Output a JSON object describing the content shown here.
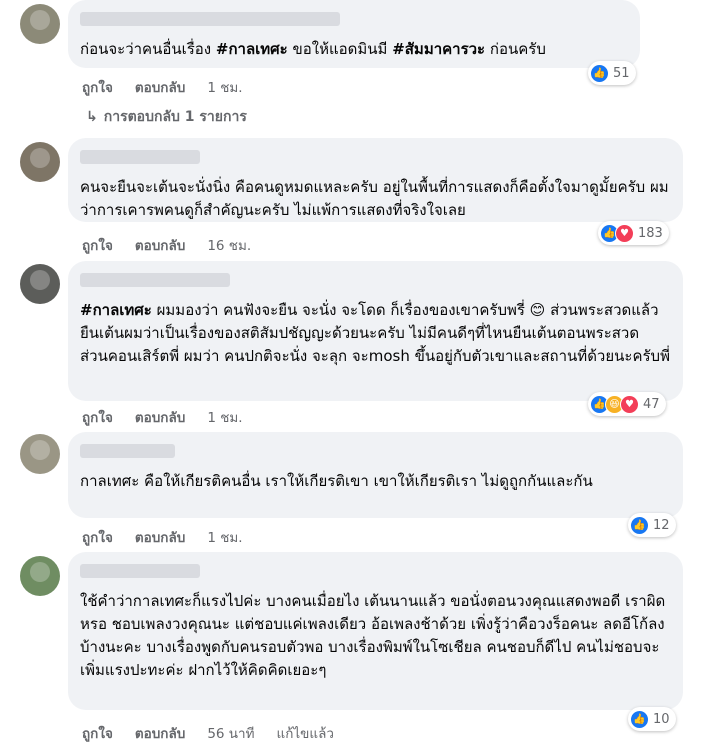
{
  "comments": [
    {
      "text_parts": [
        "ก่อนจะว่าคนอื่นเรื่อง ",
        "#กาลเทศะ",
        " ขอให้แอดมินมี ",
        "#สัมมาคารวะ",
        " ก่อนครับ"
      ],
      "like": "ถูกใจ",
      "reply": "ตอบกลับ",
      "time": "1 ชม.",
      "reaction_count": "51",
      "view_replies": "การตอบกลับ 1 รายการ"
    },
    {
      "text": "คนจะยืนจะเต้นจะนั่งนิ่ง คือคนดูหมดแหละครับ อยู่ในพื้นที่การแสดงก็คือตั้งใจมาดูมั้ยครับ ผมว่าการเคารพคนดูก็สำคัญนะครับ ไม่แพ้การแสดงที่จริงใจเลย",
      "like": "ถูกใจ",
      "reply": "ตอบกลับ",
      "time": "16 ชม.",
      "reaction_count": "183"
    },
    {
      "hashtag": "#กาลเทศะ",
      "text": " ผมมองว่า คนฟังจะยืน จะนั่ง จะโดด ก็เรื่องของเขาครับพรี่ 😊 ส่วนพระสวดแล้วยืนเต้นผมว่าเป็นเรื่องของสติสัมปชัญญะด้วยนะครับ ไม่มีคนดีๆที่ไหนยืนเต้นตอนพระสวด ส่วนคอนเสิร์ตพี่ ผมว่า คนปกติจะนั่ง จะลุก จะmosh ขึ้นอยู่กับตัวเขาและสถานที่ด้วยนะครับพี่",
      "like": "ถูกใจ",
      "reply": "ตอบกลับ",
      "time": "1 ชม.",
      "reaction_count": "47"
    },
    {
      "text": "กาลเทศะ คือให้เกียรติคนอื่น เราให้เกียรติเขา เขาให้เกียรติเรา ไม่ดูถูกกันและกัน",
      "like": "ถูกใจ",
      "reply": "ตอบกลับ",
      "time": "1 ชม.",
      "reaction_count": "12"
    },
    {
      "text": "ใช้คำว่ากาลเทศะก็แรงไปค่ะ บางคนเมื่อยไง เต้นนานแล้ว ขอนั่งตอนวงคุณแสดงพอดี เราผิดหรอ ชอบเพลงวงคุณนะ แต่ชอบแค่เพลงเดียว อ้อเพลงช้าด้วย เพิ่งรู้ว่าคือวงร็อคนะ ลดอีโก้ลงบ้างนะคะ บางเรื่องพูดกับคนรอบตัวพอ บางเรื่องพิมพ์ในโซเชียล คนชอบก็ดีไป คนไม่ชอบจะเพิ่มแรงปะทะค่ะ ฝากไว้ให้คิดคิดเยอะๆ",
      "like": "ถูกใจ",
      "reply": "ตอบกลับ",
      "time": "56 นาที",
      "edited": "แก้ไขแล้ว",
      "reaction_count": "10"
    }
  ],
  "colors": {
    "like": "#1877f2",
    "love": "#f33e58",
    "haha": "#f7b125",
    "bubble": "#f0f2f5"
  }
}
